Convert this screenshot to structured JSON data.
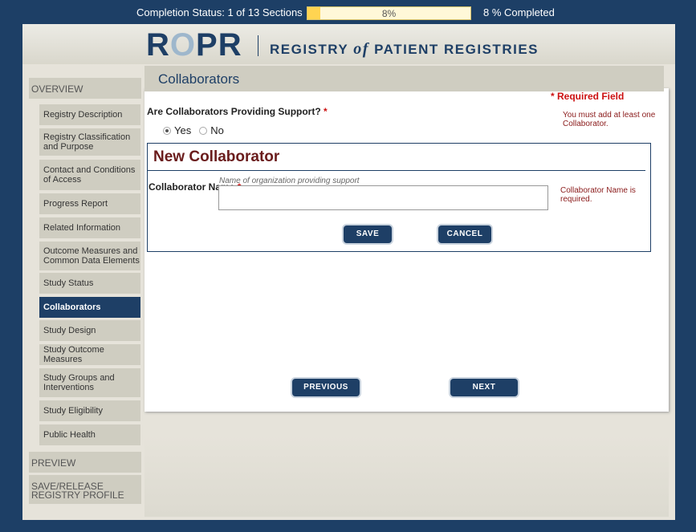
{
  "status": {
    "label": "Completion Status: 1 of 13 Sections",
    "percent_text": "8%",
    "percent_value": 8,
    "completed_text": "8 % Completed"
  },
  "header": {
    "logo_r1": "R",
    "logo_o": "O",
    "logo_rest": "PR",
    "tagline_pre": "REGISTRY",
    "tagline_of": "of",
    "tagline_post": "PATIENT REGISTRIES"
  },
  "sidebar": {
    "overview": "OVERVIEW",
    "items": [
      "Registry Description",
      "Registry Classification and Purpose",
      "Contact and Conditions of Access",
      "Progress Report",
      "Related Information",
      "Outcome Measures and Common Data Elements",
      "Study Status",
      "Collaborators",
      "Study Design",
      "Study Outcome Measures",
      "Study Groups and Interventions",
      "Study Eligibility",
      "Public Health"
    ],
    "preview": "PREVIEW",
    "save_release": "SAVE/RELEASE REGISTRY PROFILE"
  },
  "main": {
    "section_title": "Collaborators",
    "required_field": "* Required Field",
    "required_note": "You must add at least one Collaborator.",
    "question": "Are Collaborators Providing Support?",
    "star": "*",
    "radio_yes": "Yes",
    "radio_no": "No",
    "new_title": "New Collaborator",
    "field_label": "Collaborator Name",
    "field_hint": "Name of organization providing support",
    "field_value": "",
    "field_error": "Collaborator Name is required.",
    "save_label": "SAVE",
    "cancel_label": "CANCEL",
    "previous_label": "PREVIOUS",
    "next_label": "NEXT"
  },
  "colors": {
    "navy": "#1e3f66",
    "progress_fill": "#ffd451",
    "required_red": "#cc1111"
  }
}
